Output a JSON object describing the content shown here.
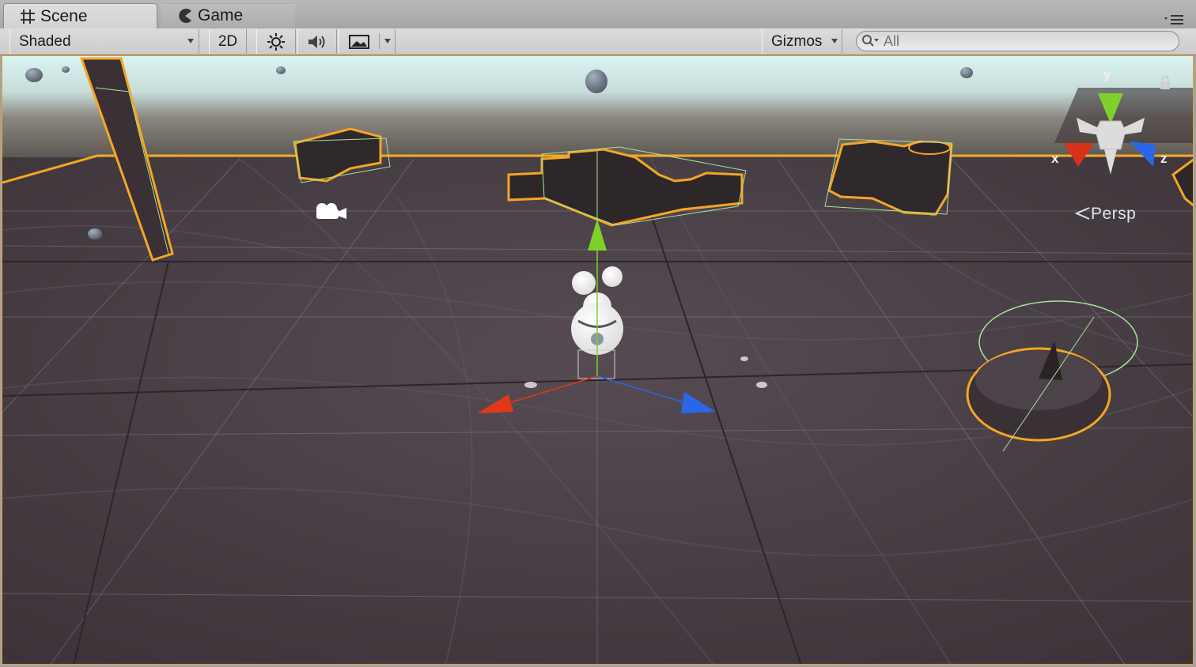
{
  "tabs": [
    {
      "label": "Scene",
      "icon": "grid-icon",
      "active": true
    },
    {
      "label": "Game",
      "icon": "pacman-icon",
      "active": false
    }
  ],
  "toolbar": {
    "draw_mode": "Shaded",
    "mode_2d": "2D",
    "gizmos": "Gizmos",
    "search_placeholder": "All"
  },
  "scene": {
    "projection_label": "Persp",
    "axis_labels": {
      "x": "x",
      "y": "y",
      "z": "z"
    }
  },
  "colors": {
    "selection_outline": "#f5a623",
    "bounds_wire": "#a6e39a",
    "axis_x": "#e0381a",
    "axis_y": "#7fd02a",
    "axis_z": "#2a67e8"
  }
}
